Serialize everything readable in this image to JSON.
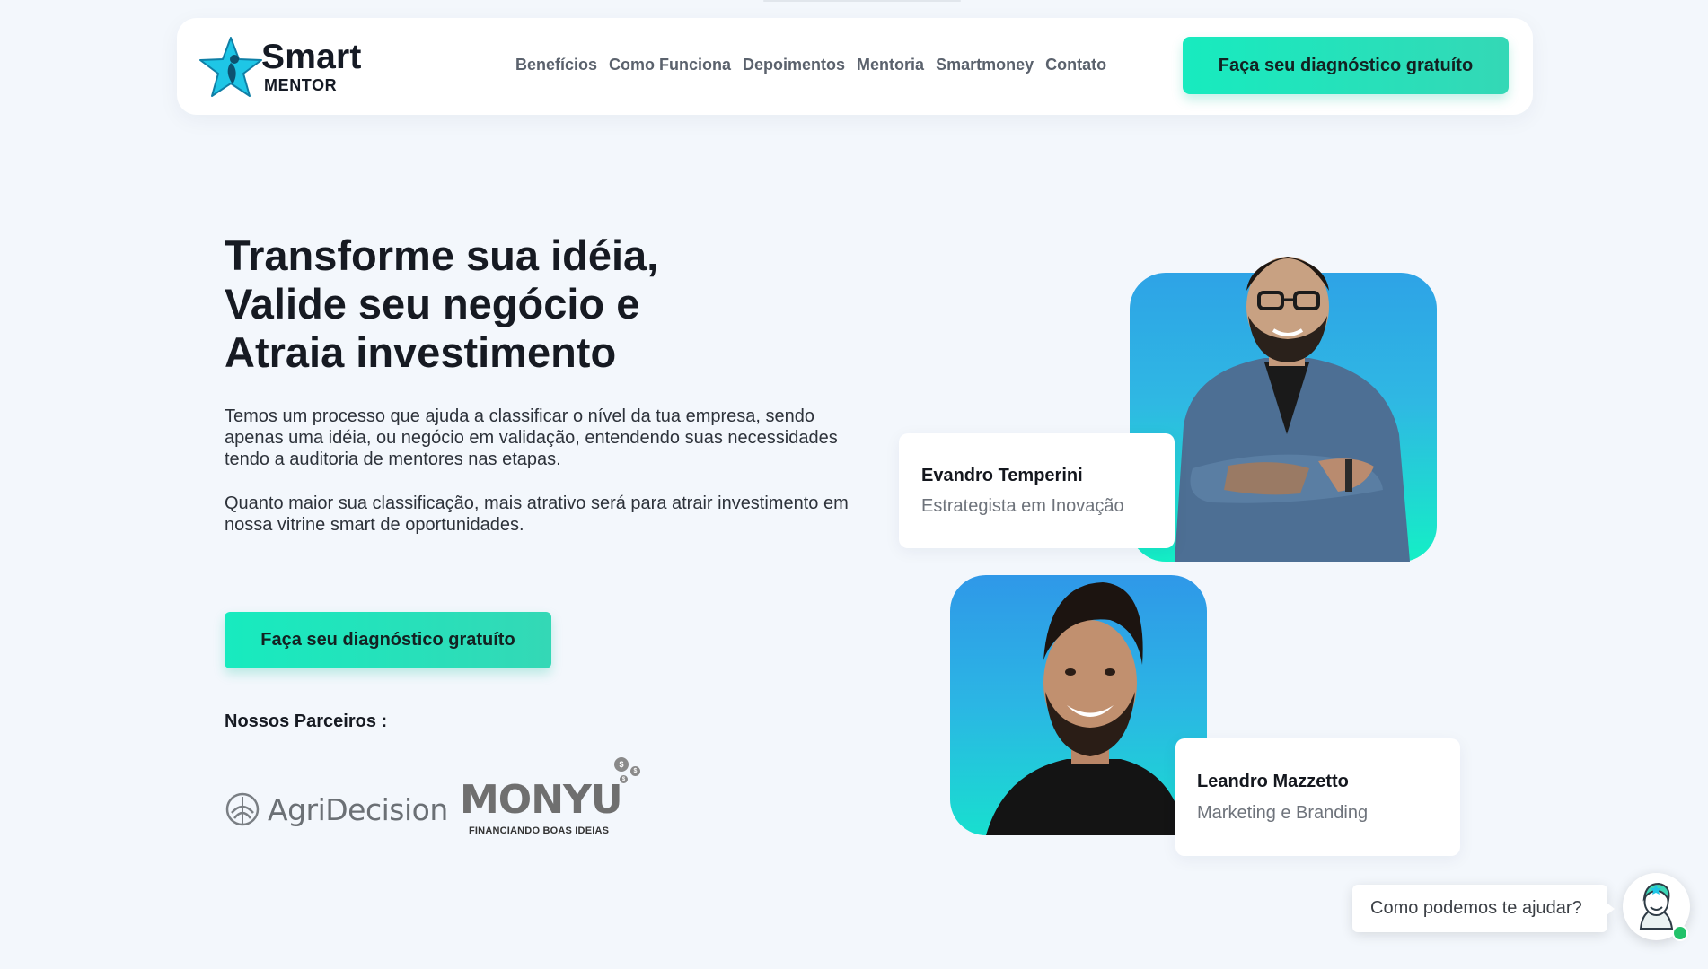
{
  "nav": {
    "logo_primary": "Smart",
    "logo_secondary": "MENTOR",
    "links": [
      "Benefícios",
      "Como Funciona",
      "Depoimentos",
      "Mentoria",
      "Smartmoney",
      "Contato"
    ],
    "cta": "Faça seu diagnóstico gratuíto"
  },
  "hero": {
    "title_lines": [
      "Transforme sua idéia,",
      "Valide seu negócio e",
      "Atraia investimento"
    ],
    "paragraph_1": "Temos um processo que ajuda a classificar o nível da tua empresa, sendo apenas uma idéia, ou negócio em validação, entendendo suas necessidades tendo a auditoria de mentores nas etapas.",
    "paragraph_2": "Quanto maior sua classificação, mais atrativo será para atrair investimento em nossa vitrine smart de oportunidades.",
    "cta": "Faça seu diagnóstico gratuíto"
  },
  "partners": {
    "label": "Nossos Parceiros :",
    "items": [
      {
        "name": "AgriDecision"
      },
      {
        "name": "MONYU",
        "tagline": "FINANCIANDO BOAS IDEIAS"
      }
    ]
  },
  "mentors": [
    {
      "name": "Evandro Temperini",
      "role": "Estrategista em Inovação"
    },
    {
      "name": "Leandro Mazzetto",
      "role": "Marketing e Branding"
    }
  ],
  "chat": {
    "prompt": "Como podemos te ajudar?"
  },
  "colors": {
    "accent": "#17ebbf",
    "photo_gradient_top": "#2ea3e6",
    "photo_gradient_bottom": "#14efc6",
    "background": "#f3f7fc"
  }
}
